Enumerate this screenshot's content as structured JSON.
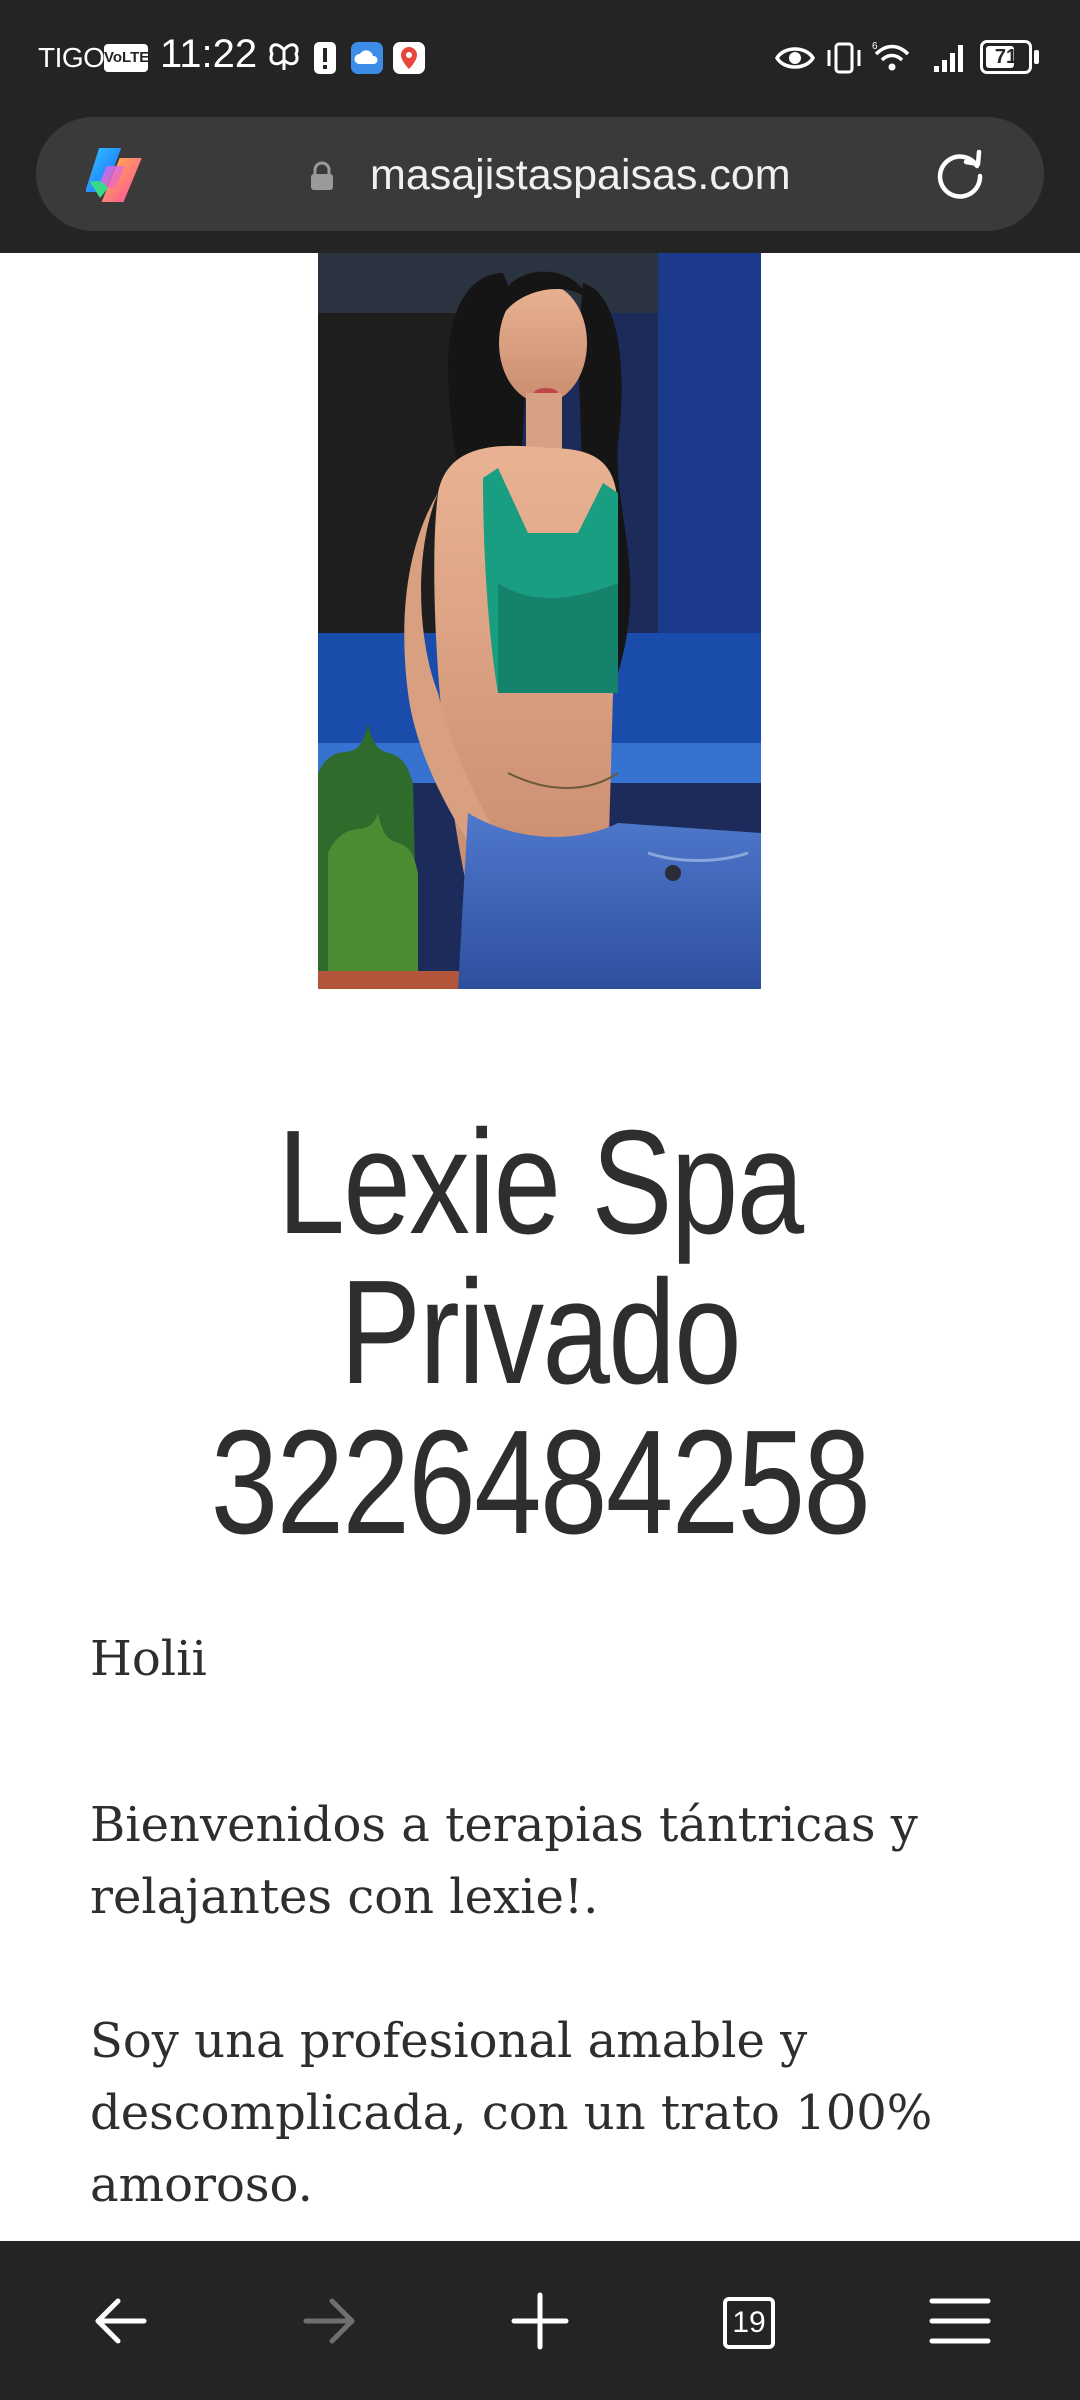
{
  "status_bar": {
    "carrier": "TIGO",
    "volte": "VoLTE",
    "time": "11:22",
    "battery": "71",
    "battery_level": 0.71
  },
  "browser": {
    "url": "masajistaspaisas.com",
    "tab_count": "19"
  },
  "page": {
    "headline_lines": [
      "Lexie Spa",
      "Privado",
      "3226484258"
    ],
    "paragraphs": [
      "Holii",
      "Bienvenidos a terapias tántricas y relajantes con lexie!.",
      "Soy una profesional amable y descomplicada, con un trato 100% amoroso."
    ]
  },
  "icons": {
    "back": "arrow-left-icon",
    "forward": "arrow-right-icon",
    "new_tab": "plus-icon",
    "tabs": "tab-counter-icon",
    "menu": "hamburger-menu-icon",
    "reload": "reload-icon",
    "lock": "lock-icon",
    "copilot": "copilot-icon"
  },
  "colors": {
    "chrome_bg": "#242424",
    "urlbar_bg": "#3a3a3a",
    "text": "#2e2e2e",
    "top_green": "#1a9e82",
    "jeans_blue": "#3d63b3"
  }
}
